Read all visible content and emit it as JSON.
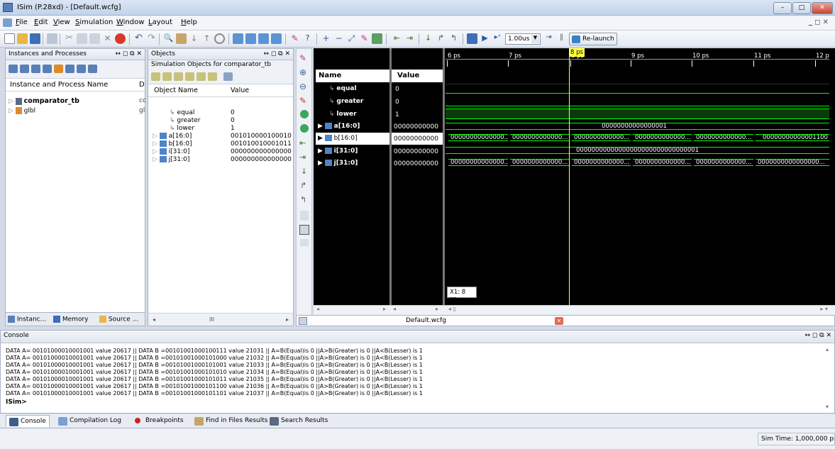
{
  "window": {
    "title": "ISim (P.28xd) - [Default.wcfg]"
  },
  "menu": [
    "File",
    "Edit",
    "View",
    "Simulation",
    "Window",
    "Layout",
    "Help"
  ],
  "toolbar": {
    "time_value": "1.00us",
    "relaunch_label": "Re-launch"
  },
  "instances_panel": {
    "title": "Instances and Processes",
    "col_name": "Instance and Process Name",
    "col_d": "D",
    "items": [
      {
        "name": "comparator_tb",
        "extra": "cc"
      },
      {
        "name": "glbl",
        "extra": "gl"
      }
    ],
    "tabs": [
      "Instanc...",
      "Memory",
      "Source ..."
    ]
  },
  "objects_panel": {
    "title": "Objects",
    "subtitle": "Simulation Objects for comparator_tb",
    "col_name": "Object Name",
    "col_value": "Value",
    "items": [
      {
        "name": "equal",
        "value": "0"
      },
      {
        "name": "greater",
        "value": "0"
      },
      {
        "name": "lower",
        "value": "1"
      },
      {
        "name": "a[16:0]",
        "value": "001010000100010"
      },
      {
        "name": "b[16:0]",
        "value": "001010010001011"
      },
      {
        "name": "i[31:0]",
        "value": "000000000000000"
      },
      {
        "name": "j[31:0]",
        "value": "000000000000000"
      }
    ],
    "scroll_label": "III"
  },
  "wave": {
    "col_name": "Name",
    "col_value": "Value",
    "cursor_label": "8 ps",
    "cursor_readout": "X1: 8 ps",
    "tab_label": "Default.wcfg",
    "ticks": [
      "6 ps",
      "7 ps",
      "8 ps",
      "9 ps",
      "10 ps",
      "11 ps",
      "12 p"
    ],
    "signals": [
      {
        "name": "equal",
        "value": "0"
      },
      {
        "name": "greater",
        "value": "0"
      },
      {
        "name": "lower",
        "value": "1"
      },
      {
        "name": "a[16:0]",
        "value": "00000000000"
      },
      {
        "name": "b[16:0]",
        "value": "00000000000"
      },
      {
        "name": "i[31:0]",
        "value": "00000000000"
      },
      {
        "name": "j[31:0]",
        "value": "00000000000"
      }
    ],
    "a_bus": "00000000000000001",
    "b_segments": [
      "00000000000000...",
      "0000000000000...",
      "0000000000000...",
      "0000000000000...",
      "0000000000000...",
      "00000000000001100"
    ],
    "i_bus": "00000000000000000000000000000001",
    "j_segments": [
      "00000000000000...",
      "0000000000000...",
      "0000000000000...",
      "0000000000000...",
      "0000000000000...",
      "0000000000000000..."
    ]
  },
  "console": {
    "title": "Console",
    "lines": [
      "DATA A= 00101000010001001  value  20617 || DATA B =00101001000100111 value  21031 || A=B(Equal)is 0 ||A>B(Greater) is 0 ||A<B(Lesser) is 1",
      "DATA A= 00101000010001001  value  20617 || DATA B =00101001000101000 value  21032 || A=B(Equal)is 0 ||A>B(Greater) is 0 ||A<B(Lesser) is 1",
      "DATA A= 00101000010001001  value  20617 || DATA B =00101001000101001 value  21033 || A=B(Equal)is 0 ||A>B(Greater) is 0 ||A<B(Lesser) is 1",
      "DATA A= 00101000010001001  value  20617 || DATA B =00101001000101010 value  21034 || A=B(Equal)is 0 ||A>B(Greater) is 0 ||A<B(Lesser) is 1",
      "DATA A= 00101000010001001  value  20617 || DATA B =00101001000101011 value  21035 || A=B(Equal)is 0 ||A>B(Greater) is 0 ||A<B(Lesser) is 1",
      "DATA A= 00101000010001001  value  20617 || DATA B =00101001000101100 value  21036 || A=B(Equal)is 0 ||A>B(Greater) is 0 ||A<B(Lesser) is 1",
      "DATA A= 00101000010001001  value  20617 || DATA B =00101001000101101 value  21037 || A=B(Equal)is 0 ||A>B(Greater) is 0 ||A<B(Lesser) is 1"
    ],
    "prompt": "ISim>"
  },
  "bottom_tabs": [
    "Console",
    "Compilation Log",
    "Breakpoints",
    "Find in Files Results",
    "Search Results"
  ],
  "status": {
    "sim_time": "Sim Time: 1,000,000 ps"
  }
}
